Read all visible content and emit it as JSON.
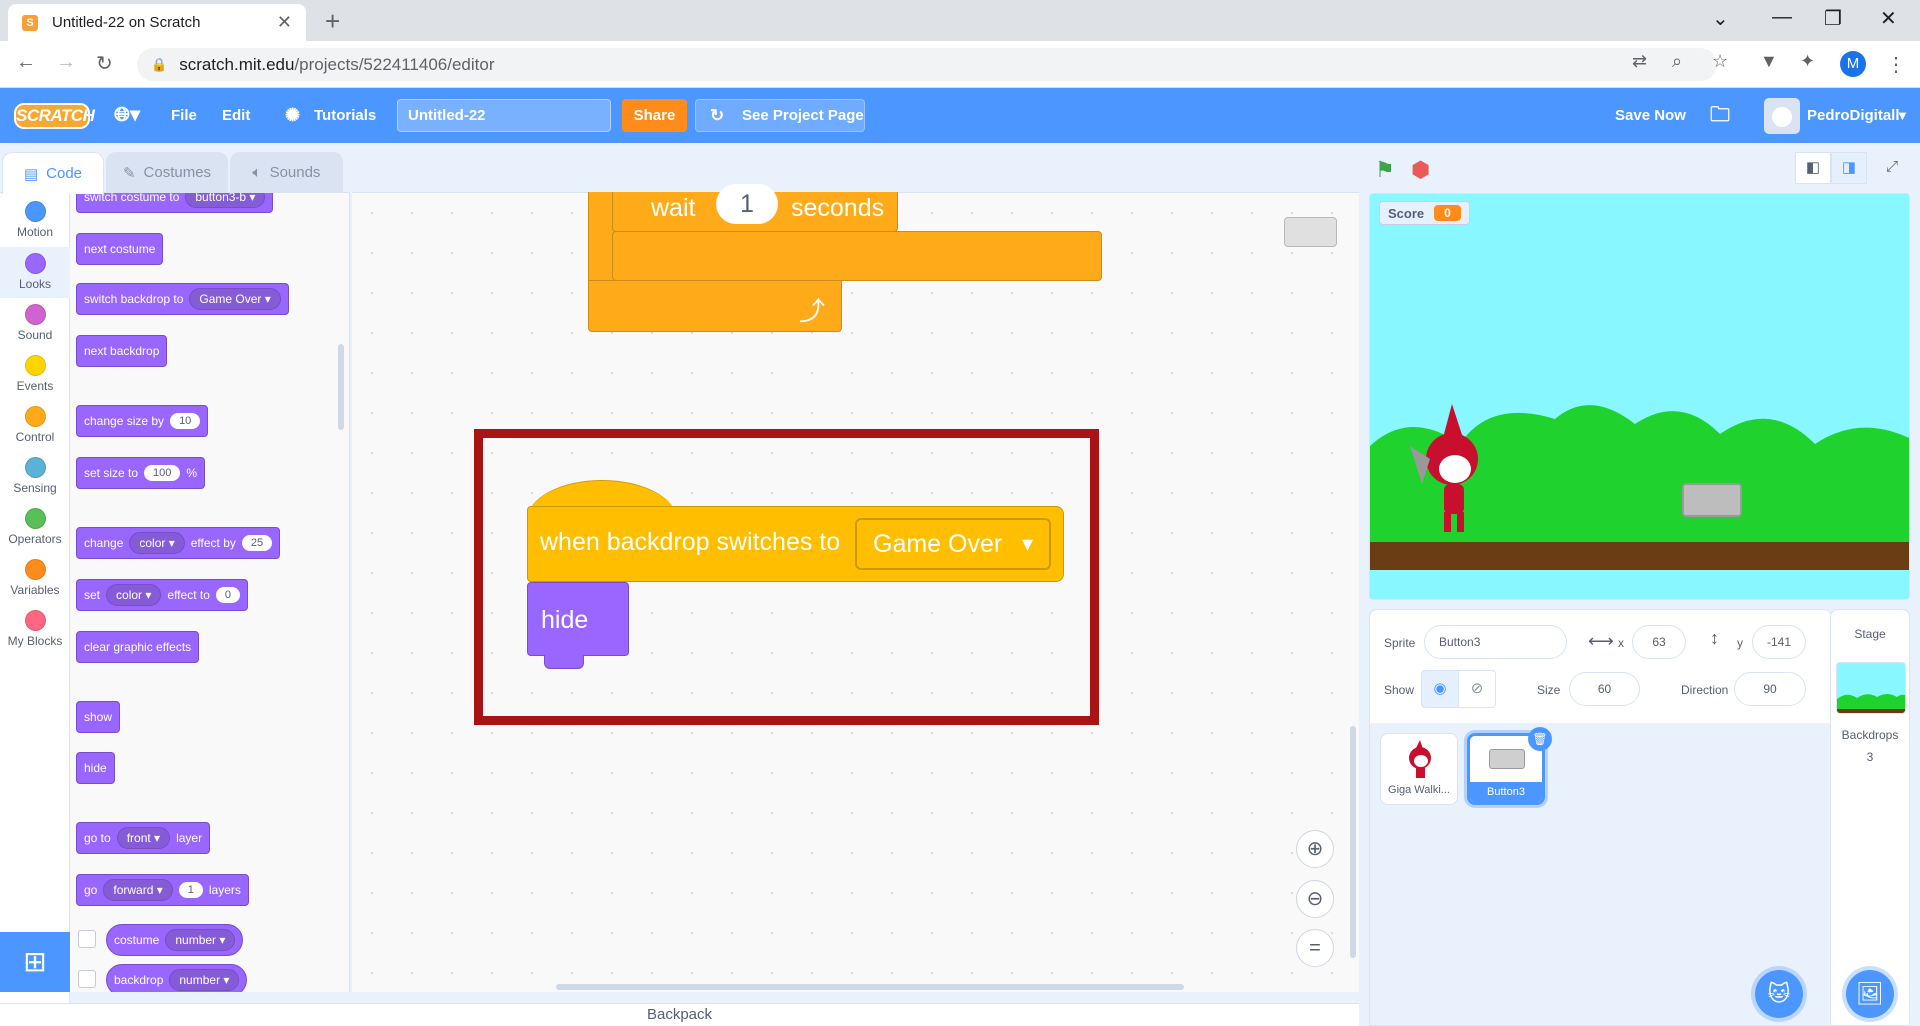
{
  "browser": {
    "tab_title": "Untitled-22 on Scratch",
    "url_domain": "scratch.mit.edu",
    "url_path": "/projects/522411406/editor",
    "profile_initial": "M"
  },
  "menubar": {
    "logo": "SCRATCH",
    "file": "File",
    "edit": "Edit",
    "tutorials": "Tutorials",
    "project_title": "Untitled-22",
    "share": "Share",
    "see_project_page": "See Project Page",
    "save_now": "Save Now",
    "username": "PedroDigitall"
  },
  "tabs": {
    "code": "Code",
    "costumes": "Costumes",
    "sounds": "Sounds"
  },
  "categories": [
    {
      "label": "Motion",
      "color": "#4c97ff"
    },
    {
      "label": "Looks",
      "color": "#9966ff"
    },
    {
      "label": "Sound",
      "color": "#cf63cf"
    },
    {
      "label": "Events",
      "color": "#ffd500"
    },
    {
      "label": "Control",
      "color": "#ffab19"
    },
    {
      "label": "Sensing",
      "color": "#5cb1d6"
    },
    {
      "label": "Operators",
      "color": "#59c059"
    },
    {
      "label": "Variables",
      "color": "#ff8c1a"
    },
    {
      "label": "My Blocks",
      "color": "#ff6680"
    }
  ],
  "palette": {
    "switch_costume": {
      "text": "switch costume to",
      "value": "button3-b"
    },
    "next_costume": "next costume",
    "switch_backdrop": {
      "text": "switch backdrop to",
      "value": "Game Over"
    },
    "next_backdrop": "next backdrop",
    "change_size": {
      "text": "change size by",
      "value": "10"
    },
    "set_size": {
      "text": "set size to",
      "value": "100",
      "suffix": "%"
    },
    "change_effect": {
      "text": "change",
      "effect": "color",
      "text2": "effect by",
      "value": "25"
    },
    "set_effect": {
      "text": "set",
      "effect": "color",
      "text2": "effect to",
      "value": "0"
    },
    "clear_effects": "clear graphic effects",
    "show": "show",
    "hide": "hide",
    "go_to_layer": {
      "text": "go to",
      "value": "front",
      "text2": "layer"
    },
    "go_layers": {
      "text": "go",
      "value": "forward",
      "num": "1",
      "text2": "layers"
    },
    "costume_reporter": {
      "text": "costume",
      "value": "number"
    },
    "backdrop_reporter": {
      "text": "backdrop",
      "value": "number"
    }
  },
  "workspace": {
    "wait_block": {
      "text1": "wait",
      "value": "1",
      "text2": "seconds"
    },
    "loop_arrow": "⤴",
    "hat_block": {
      "text": "when backdrop switches to",
      "value": "Game Over"
    },
    "hide_block": "hide",
    "highlight_color": "#a91313"
  },
  "stage": {
    "score_label": "Score",
    "score_value": "0"
  },
  "sprite_info": {
    "sprite_label": "Sprite",
    "sprite_name": "Button3",
    "x_label": "x",
    "x_value": "63",
    "y_label": "y",
    "y_value": "-141",
    "show_label": "Show",
    "size_label": "Size",
    "size_value": "60",
    "direction_label": "Direction",
    "direction_value": "90"
  },
  "sprites": [
    {
      "name": "Giga Walki..."
    },
    {
      "name": "Button3",
      "selected": true
    }
  ],
  "stage_pane": {
    "title": "Stage",
    "backdrops_label": "Backdrops",
    "backdrops_count": "3"
  },
  "backpack": "Backpack"
}
